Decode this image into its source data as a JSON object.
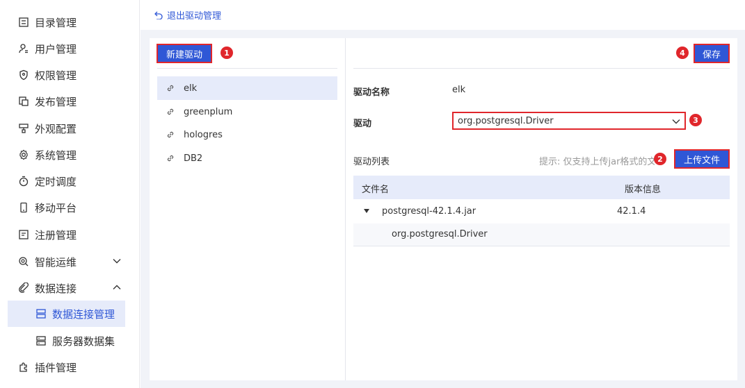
{
  "sidebar": {
    "items": [
      {
        "label": "目录管理",
        "icon": "list-icon"
      },
      {
        "label": "用户管理",
        "icon": "user-icon"
      },
      {
        "label": "权限管理",
        "icon": "shield-icon"
      },
      {
        "label": "发布管理",
        "icon": "publish-icon"
      },
      {
        "label": "外观配置",
        "icon": "appearance-icon"
      },
      {
        "label": "系统管理",
        "icon": "gear-icon"
      },
      {
        "label": "定时调度",
        "icon": "timer-icon"
      },
      {
        "label": "移动平台",
        "icon": "mobile-icon"
      },
      {
        "label": "注册管理",
        "icon": "register-icon"
      },
      {
        "label": "智能运维",
        "icon": "ops-icon"
      },
      {
        "label": "数据连接",
        "icon": "link-icon"
      }
    ],
    "sub_items": [
      {
        "label": "数据连接管理",
        "icon": "database-icon"
      },
      {
        "label": "服务器数据集",
        "icon": "server-dataset-icon"
      }
    ],
    "last_item": {
      "label": "插件管理",
      "icon": "plugin-icon"
    }
  },
  "topbar": {
    "back_label": "退出驱动管理"
  },
  "left_panel": {
    "new_button": "新建驱动",
    "new_badge": "1",
    "drivers": [
      "elk",
      "greenplum",
      "hologres",
      "DB2"
    ]
  },
  "right_panel": {
    "save_button": "保存",
    "save_badge": "4",
    "name_label": "驱动名称",
    "name_value": "elk",
    "driver_label": "驱动",
    "driver_value": "org.postgresql.Driver",
    "driver_badge": "3",
    "list_label": "驱动列表",
    "hint": "提示: 仅支持上传jar格式的文",
    "upload_badge": "2",
    "upload_button": "上传文件",
    "table": {
      "col_file": "文件名",
      "col_version": "版本信息",
      "rows": [
        {
          "file": "postgresql-42.1.4.jar",
          "version": "42.1.4",
          "child": "org.postgresql.Driver"
        }
      ]
    }
  },
  "colors": {
    "accent": "#2f57d6",
    "highlight": "#e0262b",
    "active_bg": "#e6ebfa"
  }
}
